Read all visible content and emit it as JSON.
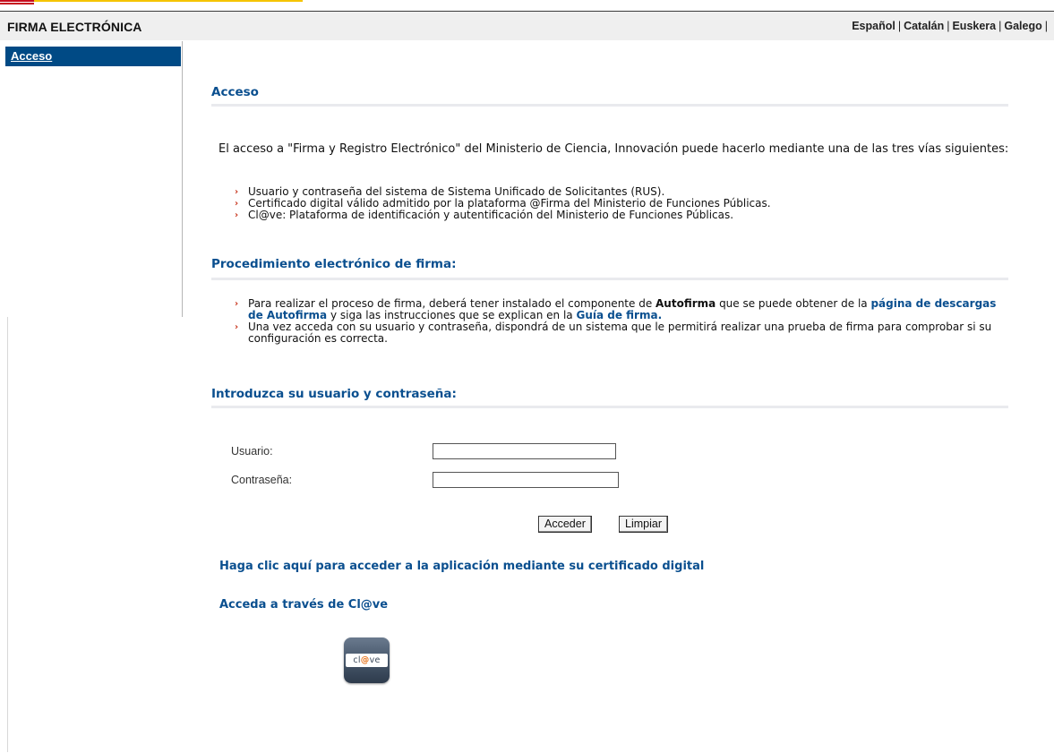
{
  "header": {
    "title": "FIRMA ELECTRÓNICA",
    "languages": [
      "Español",
      "Catalán",
      "Euskera",
      "Galego"
    ],
    "separator": "|"
  },
  "sidebar": {
    "items": [
      {
        "label": "Acceso"
      }
    ]
  },
  "main": {
    "access_section": {
      "title": "Acceso",
      "intro": "El acceso a \"Firma y Registro Electrónico\" del Ministerio de Ciencia, Innovación puede hacerlo mediante una de las tres vías siguientes:",
      "items": [
        "Usuario y contraseña del sistema de Sistema Unificado de Solicitantes (RUS).",
        "Certificado digital válido admitido por la plataforma @Firma del Ministerio de Funciones Públicas.",
        "Cl@ve: Plataforma de identificación y autentificación del Ministerio de Funciones Públicas."
      ]
    },
    "procedure_section": {
      "title": "Procedimiento electrónico de firma:",
      "item1_prefix": "Para realizar el proceso de firma, deberá tener instalado el componente de ",
      "item1_bold": "Autofirma",
      "item1_middle": " que se puede obtener de la ",
      "item1_link": "página de descargas de Autofirma",
      "item1_middle2": " y siga las instrucciones que se explican en la ",
      "item1_link2": "Guía de firma.",
      "item2": "Una vez acceda con su usuario y contraseña, dispondrá de un sistema que le permitirá realizar una prueba de firma para comprobar si su configuración es correcta."
    },
    "login_section": {
      "title": "Introduzca su usuario y contraseña:",
      "username_label": "Usuario:",
      "username_value": "",
      "password_label": "Contraseña:",
      "password_value": "",
      "submit_label": "Acceder",
      "clear_label": "Limpiar"
    },
    "certificate_link": "Haga clic aquí para acceder a la aplicación mediante su certificado digital",
    "clave_link": "Acceda a través de Cl@ve",
    "clave_logo": {
      "text_before": "cl",
      "at": "@",
      "text_after": "ve",
      "icon": "clave-logo-icon"
    }
  },
  "colors": {
    "sidebar_active_bg": "#004a85",
    "section_title": "#0a4f8f",
    "bullet_arrow": "#c8361e"
  }
}
